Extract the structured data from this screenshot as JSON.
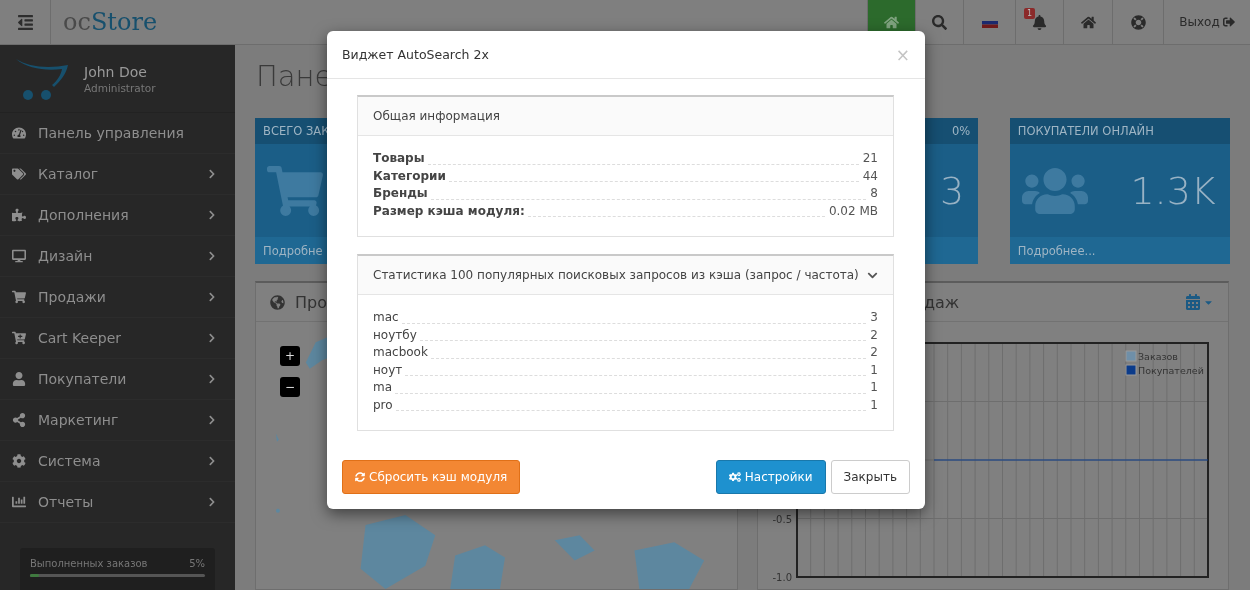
{
  "header": {
    "logo_prefix": "oc",
    "logo_name": "Store",
    "nav": [
      {
        "kind": "home",
        "selected": true
      },
      {
        "kind": "search",
        "selected": false
      },
      {
        "kind": "flag",
        "selected": false
      },
      {
        "kind": "bell",
        "selected": false,
        "badge": "1"
      },
      {
        "kind": "home",
        "selected": false
      },
      {
        "kind": "help",
        "selected": false
      }
    ],
    "logout": "Выход"
  },
  "sidebar": {
    "user": {
      "name": "John Doe",
      "role": "Administrator"
    },
    "items": [
      {
        "label": "Панель управления",
        "expandable": false
      },
      {
        "label": "Каталог",
        "expandable": true
      },
      {
        "label": "Дополнения",
        "expandable": true
      },
      {
        "label": "Дизайн",
        "expandable": true
      },
      {
        "label": "Продажи",
        "expandable": true
      },
      {
        "label": "Cart Keeper",
        "expandable": true
      },
      {
        "label": "Покупатели",
        "expandable": true
      },
      {
        "label": "Маркетинг",
        "expandable": true
      },
      {
        "label": "Система",
        "expandable": true
      },
      {
        "label": "Отчеты",
        "expandable": true
      }
    ],
    "progress": {
      "label": "Выполненных заказов",
      "value": "5%",
      "level": 0.05
    }
  },
  "page": {
    "title": "Пане",
    "tiles": [
      {
        "title": "ВСЕГО ЗАК",
        "footer": "Подробне"
      },
      {
        "badge": "0%",
        "value": "3"
      },
      {
        "title": "ПОКУПАТЕЛИ ОНЛАЙН",
        "value": "1.3K",
        "footer": "Подробнее..."
      }
    ],
    "map_panel": {
      "title": "Про",
      "zoom_in": "+",
      "zoom_out": "−"
    },
    "chart_panel": {
      "title": "даж",
      "chart_data": {
        "type": "line",
        "ylim": [
          -1,
          1
        ],
        "yticks": [
          {
            "value": -1,
            "label": "-1.0"
          },
          {
            "value": -0.5,
            "label": "-0.5"
          }
        ],
        "grid": true,
        "legend": true,
        "series": [
          {
            "name": "Заказов",
            "color": "#6f8fa8"
          },
          {
            "name": "Покупателей",
            "color": "#0b3b8a",
            "values": [
              null,
              null,
              null,
              null,
              null,
              null,
              null,
              null,
              null,
              null,
              0,
              0,
              0,
              0,
              0,
              0,
              0,
              0,
              0,
              0,
              0,
              0,
              0,
              0,
              0,
              0,
              0,
              0,
              0,
              0,
              0
            ]
          }
        ]
      }
    }
  },
  "modal": {
    "title": "Виджет AutoSearch 2x",
    "close": "×",
    "info": {
      "title": "Общая информация",
      "rows": [
        {
          "label": "Товары",
          "value": "21"
        },
        {
          "label": "Категории",
          "value": "44"
        },
        {
          "label": "Бренды",
          "value": "8"
        },
        {
          "label": "Размер кэша модуля:",
          "value": "0.02 MB"
        }
      ]
    },
    "stats": {
      "title": "Статистика 100 популярных поисковых запросов из кэша (запрос / частота)",
      "expanded": true,
      "rows": [
        {
          "label": "mac",
          "value": "3"
        },
        {
          "label": "ноутбу",
          "value": "2"
        },
        {
          "label": "macbook",
          "value": "2"
        },
        {
          "label": "ноут",
          "value": "1"
        },
        {
          "label": "ma",
          "value": "1"
        },
        {
          "label": "pro",
          "value": "1"
        }
      ]
    },
    "buttons": [
      {
        "kind": "reset",
        "label": "Сбросить кэш модуля"
      },
      {
        "kind": "settings",
        "label": "Настройки"
      },
      {
        "kind": "close",
        "label": "Закрыть"
      }
    ]
  }
}
